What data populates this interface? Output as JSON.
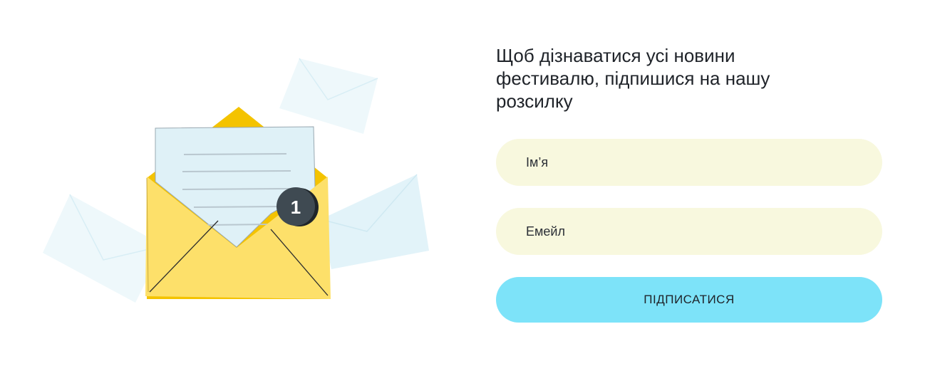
{
  "newsletter": {
    "heading": "Щоб дізнаватися усі новини фестивалю, підпишися на нашу розсилку",
    "name_placeholder": "Ім’я",
    "email_placeholder": "Емейл",
    "submit_label": "ПІДПИСАТИСЯ"
  },
  "illustration": {
    "badge_count": "1",
    "colors": {
      "envelope": "#fde06a",
      "envelope_flap": "#f4c300",
      "letter": "#dff1f7",
      "background_envelopes": "#e6f5fa",
      "badge": "#3f4a52"
    }
  },
  "colors": {
    "input_background": "#f8f8de",
    "button_background": "#7de3f9"
  }
}
